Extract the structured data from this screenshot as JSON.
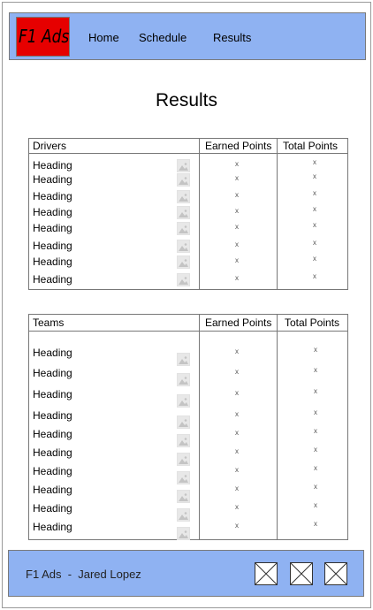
{
  "header": {
    "logo_text": "F1 Ads",
    "nav": [
      {
        "label": "Home"
      },
      {
        "label": "Schedule"
      },
      {
        "label": "Results"
      }
    ]
  },
  "page_title": "Results",
  "drivers_table": {
    "headers": [
      "Drivers",
      "Earned Points",
      "Total Points"
    ],
    "rows": [
      {
        "label": "Heading",
        "earned": "x",
        "total": "x"
      },
      {
        "label": "Heading",
        "earned": "x",
        "total": "x"
      },
      {
        "label": "Heading",
        "earned": "x",
        "total": "x"
      },
      {
        "label": "Heading",
        "earned": "x",
        "total": "x"
      },
      {
        "label": "Heading",
        "earned": "x",
        "total": "x"
      },
      {
        "label": "Heading",
        "earned": "x",
        "total": "x"
      },
      {
        "label": "Heading",
        "earned": "x",
        "total": "x"
      },
      {
        "label": "Heading",
        "earned": "x",
        "total": "x"
      }
    ]
  },
  "teams_table": {
    "headers": [
      "Teams",
      "Earned Points",
      "Total Points"
    ],
    "rows": [
      {
        "label": "Heading",
        "earned": "x",
        "total": "x"
      },
      {
        "label": "Heading",
        "earned": "x",
        "total": "x"
      },
      {
        "label": "Heading",
        "earned": "x",
        "total": "x"
      },
      {
        "label": "Heading",
        "earned": "x",
        "total": "x"
      },
      {
        "label": "Heading",
        "earned": "x",
        "total": "x"
      },
      {
        "label": "Heading",
        "earned": "x",
        "total": "x"
      },
      {
        "label": "Heading",
        "earned": "x",
        "total": "x"
      },
      {
        "label": "Heading",
        "earned": "x",
        "total": "x"
      },
      {
        "label": "Heading",
        "earned": "x",
        "total": "x"
      },
      {
        "label": "Heading",
        "earned": "x",
        "total": "x"
      }
    ]
  },
  "footer": {
    "text": "F1 Ads  -  Jared Lopez",
    "icons": [
      "image-placeholder-icon",
      "image-placeholder-icon",
      "image-placeholder-icon"
    ]
  },
  "colors": {
    "bar_background": "#8fb2f2",
    "logo_background": "#e60000"
  }
}
